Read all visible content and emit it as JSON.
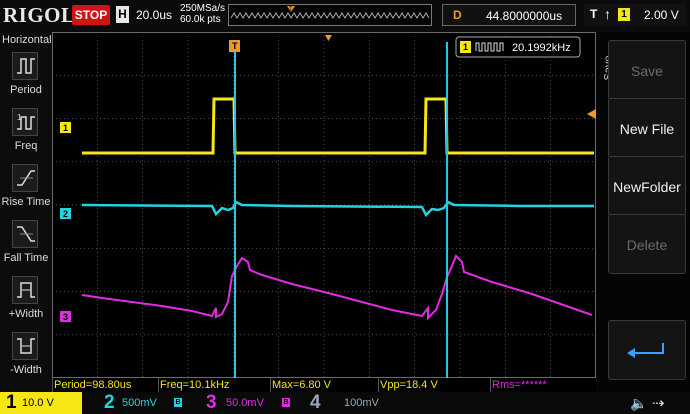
{
  "header": {
    "brand": "RIGOL",
    "run_state": "STOP",
    "horizontal_label": "H",
    "timebase": "20.0us",
    "sample_rate": "250MSa/s",
    "memory_depth": "60.0k pts",
    "delay_label": "D",
    "delay_value": "44.8000000us",
    "trigger_label": "T",
    "trigger_source": "1",
    "trigger_level": "2.00 V"
  },
  "left_menu": {
    "title": "Horizontal",
    "items": [
      {
        "label": "Period",
        "icon": "period-icon"
      },
      {
        "label": "Freq",
        "icon": "frequency-icon"
      },
      {
        "label": "Rise Time",
        "icon": "rise-time-icon"
      },
      {
        "label": "Fall Time",
        "icon": "fall-time-icon"
      },
      {
        "label": "+Width",
        "icon": "positive-width-icon"
      },
      {
        "label": "-Width",
        "icon": "negative-width-icon"
      }
    ]
  },
  "counter": {
    "channel": "1",
    "value": "20.1992kHz"
  },
  "right_menu": {
    "title": "Save",
    "buttons": [
      {
        "label": "Save",
        "enabled": false
      },
      {
        "label": "New File",
        "enabled": true
      },
      {
        "label": "NewFolder",
        "enabled": true
      },
      {
        "label": "Delete",
        "enabled": false
      }
    ],
    "return_icon": "return-arrow-icon"
  },
  "measurements": [
    {
      "text": "Period=98.80us"
    },
    {
      "text": "Freq=10.1kHz"
    },
    {
      "text": "Max=6.80 V"
    },
    {
      "text": "Vpp=18.4 V"
    },
    {
      "text": "Rms=******"
    }
  ],
  "channels": [
    {
      "num": "1",
      "scale": "10.0 V",
      "color": "#f5e614",
      "active": true
    },
    {
      "num": "2",
      "scale": "500mV",
      "color": "#25d3e0"
    },
    {
      "num": "3",
      "scale": "50.0mV",
      "color": "#e02ce0"
    },
    {
      "num": "4",
      "scale": "100mV",
      "color": "#4a7fd6"
    }
  ],
  "colors": {
    "ch1": "#f5e614",
    "ch2": "#25d3e0",
    "ch3": "#e02ce0",
    "ch4": "#4a7fd6",
    "trigger": "#f09a24",
    "grid": "#6a6a6a"
  },
  "status_icons": [
    "speaker-icon",
    "usb-icon"
  ],
  "markers": {
    "ch1": "1",
    "ch2": "2",
    "ch3": "3",
    "trigger_pos": "T"
  }
}
